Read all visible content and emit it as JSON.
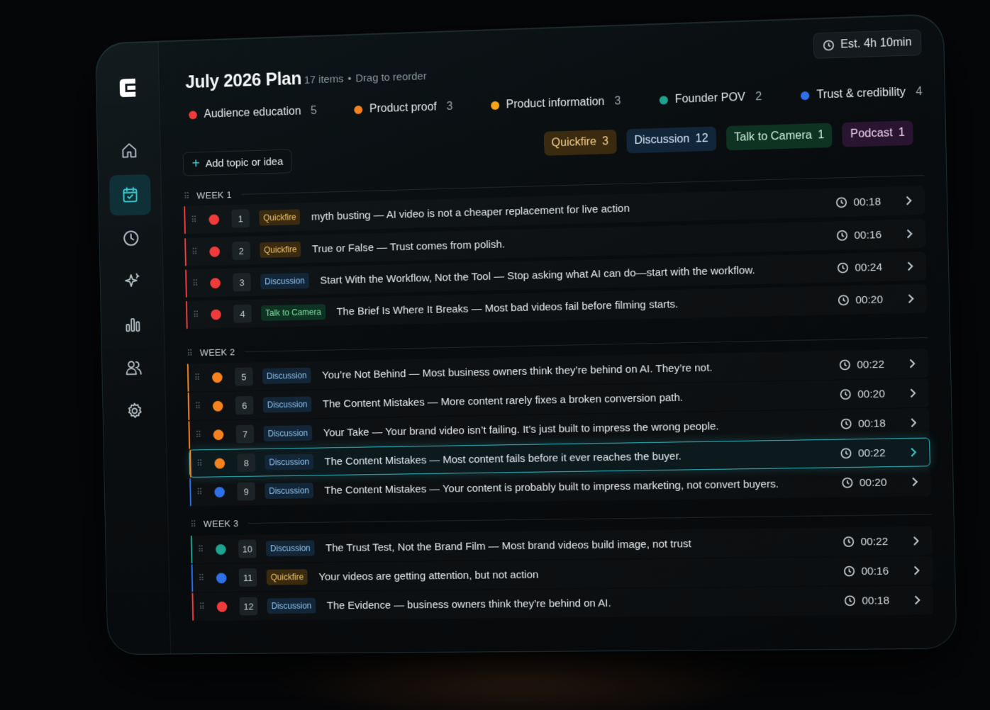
{
  "header": {
    "title": "July 2026 Plan",
    "item_count": "17 items",
    "separator": "•",
    "hint": "Drag to reorder",
    "estimate": "Est. 4h 10min"
  },
  "categories": [
    {
      "label": "Audience education",
      "count": "5",
      "color": "#ef3b3b"
    },
    {
      "label": "Product proof",
      "count": "3",
      "color": "#f6821f"
    },
    {
      "label": "Product information",
      "count": "3",
      "color": "#f7a21b"
    },
    {
      "label": "Founder POV",
      "count": "2",
      "color": "#1fa28f"
    },
    {
      "label": "Trust & credibility",
      "count": "4",
      "color": "#2f6fe8"
    }
  ],
  "add_button": {
    "label": "Add topic or idea"
  },
  "types": [
    {
      "label": "Quickfire",
      "count": "3",
      "bg": "#3a2a10",
      "fg": "#f4d08a"
    },
    {
      "label": "Discussion",
      "count": "12",
      "bg": "#12263a",
      "fg": "#d5e8f8"
    },
    {
      "label": "Talk to Camera",
      "count": "1",
      "bg": "#0f3322",
      "fg": "#cdeedb"
    },
    {
      "label": "Podcast",
      "count": "1",
      "bg": "#2a1530",
      "fg": "#ecd3f3"
    }
  ],
  "weeks": [
    {
      "label": "WEEK 1"
    },
    {
      "label": "WEEK 2"
    },
    {
      "label": "WEEK 3"
    }
  ],
  "items": [
    {
      "num": "1",
      "tag": "Quickfire",
      "text": "myth busting — AI video is not a cheaper replacement for live action",
      "time": "00:18",
      "color": "#ef3b3b"
    },
    {
      "num": "2",
      "tag": "Quickfire",
      "text": "True or False — Trust comes from polish.",
      "time": "00:16",
      "color": "#ef3b3b"
    },
    {
      "num": "3",
      "tag": "Discussion",
      "text": "Start With the Workflow, Not the Tool — Stop asking what AI can do—start with the workflow.",
      "time": "00:24",
      "color": "#ef3b3b"
    },
    {
      "num": "4",
      "tag": "Talk to Camera",
      "text": "The Brief Is Where It Breaks — Most bad videos fail before filming starts.",
      "time": "00:20",
      "color": "#ef3b3b"
    },
    {
      "num": "5",
      "tag": "Discussion",
      "text": "You’re Not Behind — Most business owners think they’re behind on AI. They’re not.",
      "time": "00:22",
      "color": "#f6821f"
    },
    {
      "num": "6",
      "tag": "Discussion",
      "text": "The Content Mistakes — More content rarely fixes a broken conversion path.",
      "time": "00:20",
      "color": "#f6821f"
    },
    {
      "num": "7",
      "tag": "Discussion",
      "text": "Your Take — Your brand video isn’t failing. It’s just built to impress the wrong people.",
      "time": "00:18",
      "color": "#f6821f"
    },
    {
      "num": "8",
      "tag": "Discussion",
      "text": "The Content Mistakes — Most content fails before it ever reaches the buyer.",
      "time": "00:22",
      "color": "#f6821f"
    },
    {
      "num": "9",
      "tag": "Discussion",
      "text": "The Content Mistakes — Your content is probably built to impress marketing, not convert buyers.",
      "time": "00:20",
      "color": "#2f6fe8"
    },
    {
      "num": "10",
      "tag": "Discussion",
      "text": "The Trust Test, Not the Brand Film — Most brand videos build image, not trust",
      "time": "00:22",
      "color": "#1fa28f"
    },
    {
      "num": "11",
      "tag": "Quickfire",
      "text": "Your videos are getting attention, but not action",
      "time": "00:16",
      "color": "#2f6fe8"
    },
    {
      "num": "12",
      "tag": "Discussion",
      "text": "The Evidence — business owners think they’re behind on AI.",
      "time": "00:18",
      "color": "#ef3b3b"
    }
  ],
  "icons": {
    "nav": [
      "home-icon",
      "calendar-icon",
      "clock-icon",
      "sparkle-icon",
      "chart-icon",
      "users-icon",
      "settings-icon"
    ]
  }
}
